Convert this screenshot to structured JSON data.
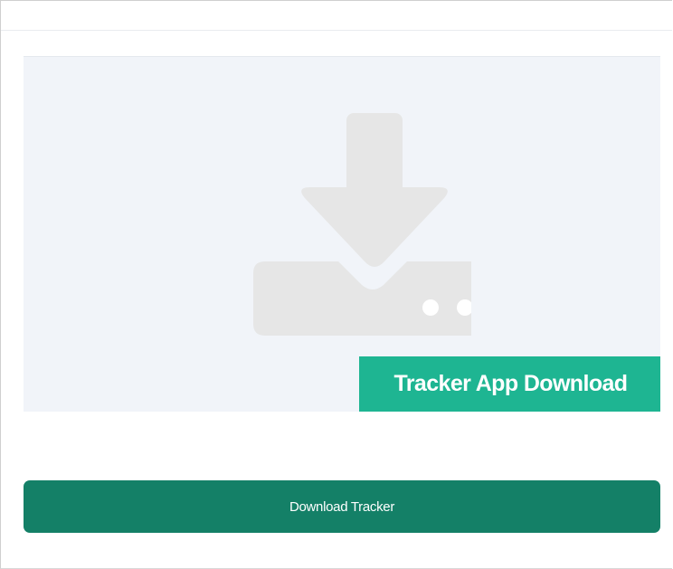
{
  "card": {
    "image_icon": "download-tray-icon",
    "caption": "Tracker App Download"
  },
  "actions": {
    "download_label": "Download Tracker"
  },
  "colors": {
    "placeholder_bg": "#f1f4f9",
    "icon_gray": "#e6e6e6",
    "caption_bg": "#1eb592",
    "button_bg": "#148067"
  }
}
